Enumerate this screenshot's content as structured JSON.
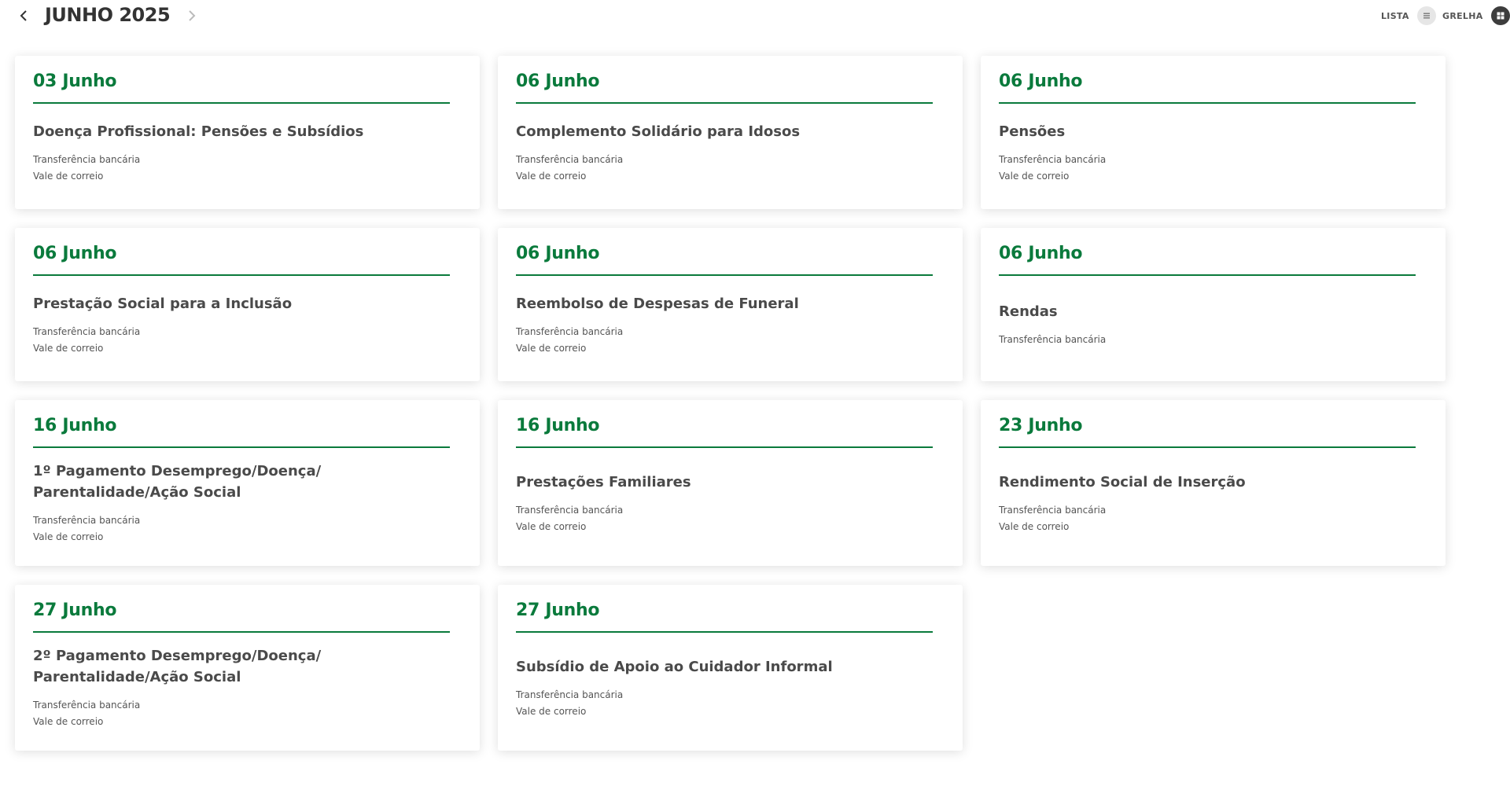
{
  "header": {
    "month_title": "JUNHO 2025",
    "view_list_label": "LISTA",
    "view_grid_label": "GRELHA",
    "active_view": "grid",
    "prev_icon": "chevron-left-icon",
    "next_icon": "chevron-right-icon"
  },
  "colors": {
    "accent_green": "#0a7a3c",
    "title_text": "#333333",
    "card_title_text": "#4a4a4a"
  },
  "payments": [
    {
      "date": "03 Junho",
      "title": "Doença Profissional: Pensões e Subsídios",
      "methods": [
        "Transferência bancária",
        "Vale de correio"
      ]
    },
    {
      "date": "06 Junho",
      "title": "Complemento Solidário para Idosos",
      "methods": [
        "Transferência bancária",
        "Vale de correio"
      ]
    },
    {
      "date": "06 Junho",
      "title": "Pensões",
      "methods": [
        "Transferência bancária",
        "Vale de correio"
      ]
    },
    {
      "date": "06 Junho",
      "title": "Prestação Social para a Inclusão",
      "methods": [
        "Transferência bancária",
        "Vale de correio"
      ]
    },
    {
      "date": "06 Junho",
      "title": "Reembolso de Despesas de Funeral",
      "methods": [
        "Transferência bancária",
        "Vale de correio"
      ]
    },
    {
      "date": "06 Junho",
      "title": "Rendas",
      "methods": [
        "Transferência bancária"
      ]
    },
    {
      "date": "16 Junho",
      "title": "1º Pagamento Desemprego/Doença/ Parentalidade/Ação Social",
      "methods": [
        "Transferência bancária",
        "Vale de correio"
      ]
    },
    {
      "date": "16 Junho",
      "title": "Prestações Familiares",
      "methods": [
        "Transferência bancária",
        "Vale de correio"
      ]
    },
    {
      "date": "23 Junho",
      "title": "Rendimento Social de Inserção",
      "methods": [
        "Transferência bancária",
        "Vale de correio"
      ]
    },
    {
      "date": "27 Junho",
      "title": "2º Pagamento Desemprego/Doença/ Parentalidade/Ação Social",
      "methods": [
        "Transferência bancária",
        "Vale de correio"
      ]
    },
    {
      "date": "27 Junho",
      "title": "Subsídio de Apoio ao Cuidador Informal",
      "methods": [
        "Transferência bancária",
        "Vale de correio"
      ]
    }
  ]
}
